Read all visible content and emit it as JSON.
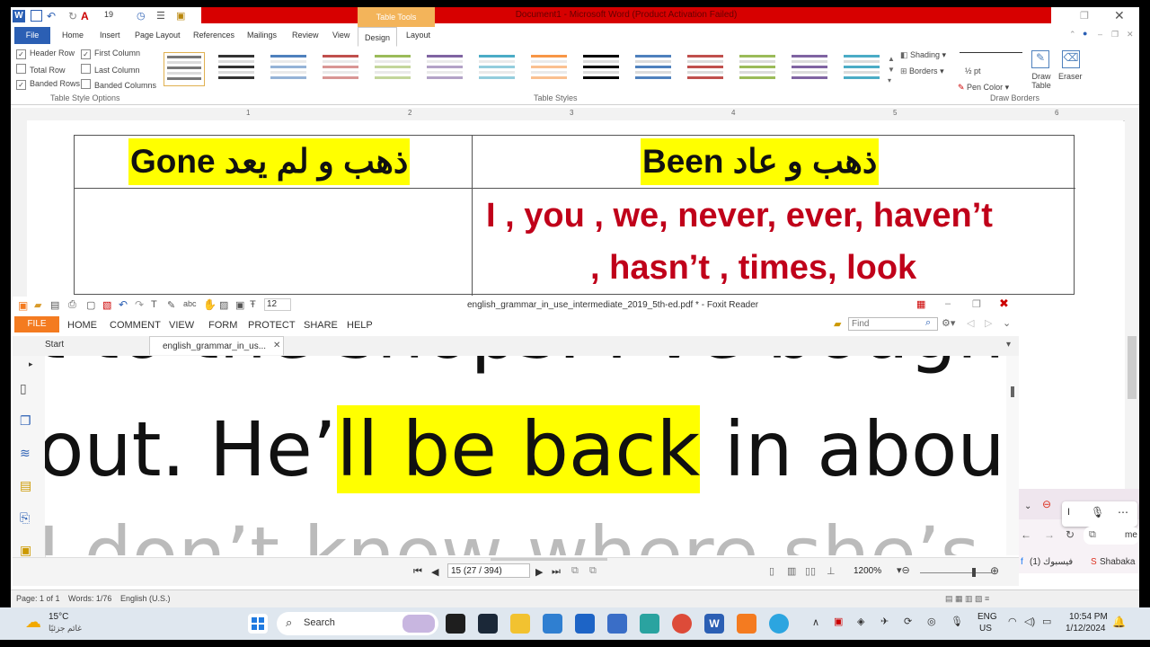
{
  "word": {
    "titlebar": "Document1 - Microsoft Word (Product Activation Failed)",
    "table_tools": "Table Tools",
    "font_size": "19",
    "tabs": [
      "File",
      "Home",
      "Insert",
      "Page Layout",
      "References",
      "Mailings",
      "Review",
      "View",
      "Design",
      "Layout"
    ],
    "table_style_options": {
      "label": "Table Style Options",
      "items": [
        {
          "label": "Header Row",
          "checked": true
        },
        {
          "label": "First Column",
          "checked": true
        },
        {
          "label": "Total Row",
          "checked": false
        },
        {
          "label": "Last Column",
          "checked": false
        },
        {
          "label": "Banded Rows",
          "checked": true
        },
        {
          "label": "Banded Columns",
          "checked": false
        }
      ]
    },
    "table_styles_label": "Table Styles",
    "style_colors": [
      "#777777",
      "#333333",
      "#4f81bd",
      "#c0504d",
      "#9bbb59",
      "#8064a2",
      "#4bacc6",
      "#f79646",
      "#000000",
      "#4f81bd",
      "#c0504d",
      "#9bbb59",
      "#8064a2",
      "#4bacc6"
    ],
    "shading_label": "Shading",
    "borders_label": "Borders",
    "pen_weight": "½ pt",
    "pen_color_label": "Pen Color",
    "draw_table_label": "Draw Table",
    "eraser_label": "Eraser",
    "draw_borders_label": "Draw Borders",
    "table": {
      "left_header": "Gone ذهب و لم يعد",
      "right_header": "Been  ذهب و عاد",
      "right_cell_line1": "I , you , we, never, ever, haven’t",
      "right_cell_line2": ", hasn’t ,  times, look"
    },
    "status": {
      "page": "Page: 1 of 1",
      "words": "Words: 1/76",
      "language": "English (U.S.)"
    }
  },
  "foxit": {
    "title": "english_grammar_in_use_intermediate_2019_5th-ed.pdf * - Foxit Reader",
    "font_size": "12",
    "menu": [
      "FILE",
      "HOME",
      "COMMENT",
      "VIEW",
      "FORM",
      "PROTECT",
      "SHARE",
      "HELP"
    ],
    "find_placeholder": "Find",
    "tab_start": "Start",
    "tab_doc": "english_grammar_in_us...",
    "page_text": {
      "line1": "t to the shops. I’ve bough",
      "line2_prefix": "out.  He’",
      "line2_highlight": "ll be back",
      "line2_suffix": " in abou",
      "line3": "I don’t know where she’s"
    },
    "page_indicator": "15 (27 / 394)",
    "zoom": "1200%",
    "highlight_color": "#ffff00"
  },
  "edge": {
    "bookmark1": "(1) فيسبوك",
    "bookmark2": "Shabaka",
    "address_fragment": "me"
  },
  "taskbar": {
    "weather_temp": "15°C",
    "weather_desc": "غائم جزئيًا",
    "search_label": "Search",
    "lang_line1": "ENG",
    "lang_line2": "US",
    "time": "10:54 PM",
    "date": "1/12/2024"
  }
}
